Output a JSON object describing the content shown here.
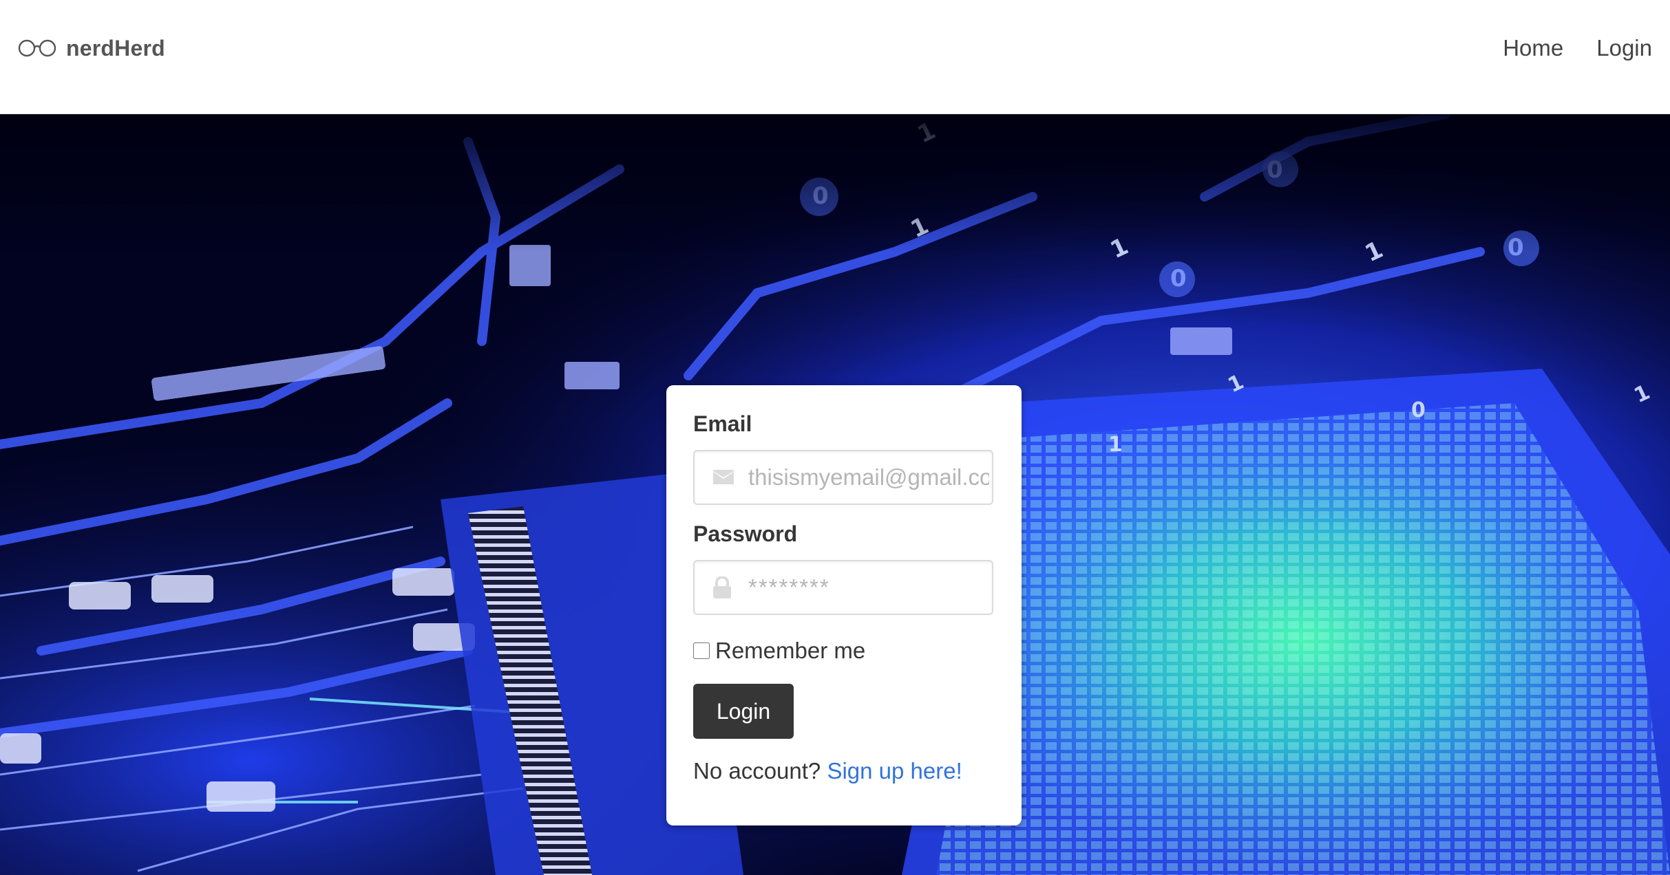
{
  "navbar": {
    "brand_name": "nerdHerd",
    "brand_icon": "glasses-icon",
    "links": [
      {
        "label": "Home"
      },
      {
        "label": "Login"
      }
    ]
  },
  "login_form": {
    "email_label": "Email",
    "email_placeholder": "thisismyemail@gmail.com",
    "email_icon": "envelope-icon",
    "password_label": "Password",
    "password_placeholder": "********",
    "password_icon": "lock-icon",
    "remember_label": "Remember me",
    "remember_checked": false,
    "submit_label": "Login",
    "signup_prompt": "No account?",
    "signup_link": "Sign up here!"
  },
  "colors": {
    "primary_button": "#363636",
    "link": "#3273dc",
    "hero_glow": "#2d4cff"
  }
}
